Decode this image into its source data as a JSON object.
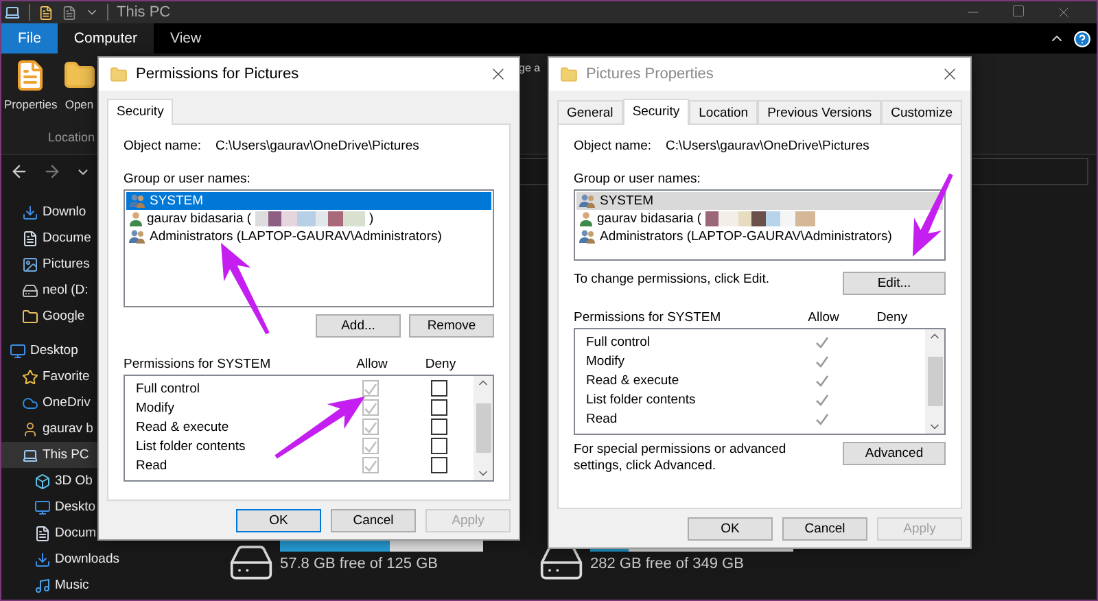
{
  "explorer": {
    "title": "This PC",
    "ribbon_tabs": [
      {
        "label": "File",
        "kind": "file",
        "selected": false
      },
      {
        "label": "Computer",
        "kind": "tab",
        "selected": true
      },
      {
        "label": "View",
        "kind": "tab",
        "selected": false
      }
    ],
    "ribbon_buttons": [
      {
        "label": "Properties",
        "kind": "properties"
      },
      {
        "label": "Open",
        "kind": "folder"
      }
    ],
    "ribbon_group": "Location",
    "ribbon_fragment": "ge a",
    "sidebar": {
      "quick_access": [
        {
          "label": "Downlo",
          "kind": "download",
          "selected": false
        },
        {
          "label": "Docume",
          "kind": "document",
          "selected": false
        },
        {
          "label": "Pictures",
          "kind": "picture",
          "selected": false
        },
        {
          "label": "neol (D:",
          "kind": "drive",
          "selected": false
        },
        {
          "label": "Google",
          "kind": "folder",
          "selected": false
        }
      ],
      "tree": [
        {
          "label": "Desktop",
          "kind": "desktop",
          "selected": false,
          "children": [
            {
              "label": "Favorite",
              "kind": "star",
              "selected": false
            },
            {
              "label": "OneDriv",
              "kind": "cloud",
              "selected": false
            },
            {
              "label": "gaurav b",
              "kind": "user",
              "selected": false
            },
            {
              "label": "This PC",
              "kind": "pc",
              "selected": true,
              "children": [
                {
                  "label": "3D Ob",
                  "kind": "cube",
                  "selected": false
                },
                {
                  "label": "Deskto",
                  "kind": "desktop",
                  "selected": false
                },
                {
                  "label": "Docum",
                  "kind": "document",
                  "selected": false
                },
                {
                  "label": "Downloads",
                  "kind": "download",
                  "selected": false
                },
                {
                  "label": "Music",
                  "kind": "music",
                  "selected": false
                }
              ]
            }
          ]
        }
      ]
    },
    "drives": [
      {
        "label": "57.8 GB free of 125 GB",
        "level": 0.54
      },
      {
        "label": "282 GB free of 349 GB",
        "level": 0.19
      }
    ]
  },
  "permissions_dialog": {
    "title": "Permissions for Pictures",
    "focused": true,
    "editable": true,
    "tabs": [
      {
        "label": "Security",
        "selected": true
      }
    ],
    "object_label": "Object name:",
    "object_value": "C:\\Users\\gaurav\\OneDrive\\Pictures",
    "group_label": "Group or user names:",
    "principals": [
      {
        "name": "SYSTEM",
        "kind": "group",
        "selected": true,
        "redacted": false
      },
      {
        "name": "gaurav bidasaria (",
        "kind": "user",
        "selected": false,
        "redacted": true,
        "suffix": ")"
      },
      {
        "name": "Administrators (LAPTOP-GAURAV\\Administrators)",
        "kind": "group",
        "selected": false,
        "redacted": false
      }
    ],
    "list_buttons": [
      {
        "label": "Add..."
      },
      {
        "label": "Remove"
      }
    ],
    "permissions_label": "Permissions for SYSTEM",
    "allow_label": "Allow",
    "deny_label": "Deny",
    "permissions": [
      {
        "name": "Full control",
        "allow": true,
        "deny": false,
        "disabled": true
      },
      {
        "name": "Modify",
        "allow": true,
        "deny": false,
        "disabled": true
      },
      {
        "name": "Read & execute",
        "allow": true,
        "deny": false,
        "disabled": true
      },
      {
        "name": "List folder contents",
        "allow": true,
        "deny": false,
        "disabled": true
      },
      {
        "name": "Read",
        "allow": true,
        "deny": false,
        "disabled": true
      }
    ],
    "buttons": [
      {
        "label": "OK",
        "default": true,
        "disabled": false
      },
      {
        "label": "Cancel",
        "default": false,
        "disabled": false
      },
      {
        "label": "Apply",
        "default": false,
        "disabled": true
      }
    ]
  },
  "properties_dialog": {
    "title": "Pictures Properties",
    "focused": false,
    "editable": false,
    "tabs": [
      {
        "label": "General",
        "selected": false
      },
      {
        "label": "Security",
        "selected": true
      },
      {
        "label": "Location",
        "selected": false
      },
      {
        "label": "Previous Versions",
        "selected": false
      },
      {
        "label": "Customize",
        "selected": false
      }
    ],
    "object_label": "Object name:",
    "object_value": "C:\\Users\\gaurav\\OneDrive\\Pictures",
    "group_label": "Group or user names:",
    "principals": [
      {
        "name": "SYSTEM",
        "kind": "group",
        "selected": true,
        "redacted": false
      },
      {
        "name": "gaurav bidasaria (",
        "kind": "user",
        "selected": false,
        "redacted": true
      },
      {
        "name": "Administrators (LAPTOP-GAURAV\\Administrators)",
        "kind": "group",
        "selected": false,
        "redacted": false
      }
    ],
    "edit_hint": "To change permissions, click Edit.",
    "edit_button": "Edit...",
    "permissions_label": "Permissions for SYSTEM",
    "allow_label": "Allow",
    "deny_label": "Deny",
    "permissions": [
      {
        "name": "Full control",
        "allow": true,
        "deny": false
      },
      {
        "name": "Modify",
        "allow": true,
        "deny": false
      },
      {
        "name": "Read & execute",
        "allow": true,
        "deny": false
      },
      {
        "name": "List folder contents",
        "allow": true,
        "deny": false
      },
      {
        "name": "Read",
        "allow": true,
        "deny": false
      }
    ],
    "advanced_hint": "For special permissions or advanced settings, click Advanced.",
    "advanced_button": "Advanced",
    "buttons": [
      {
        "label": "OK",
        "default": false,
        "disabled": false
      },
      {
        "label": "Cancel",
        "default": false,
        "disabled": false
      },
      {
        "label": "Apply",
        "default": false,
        "disabled": true
      }
    ]
  }
}
